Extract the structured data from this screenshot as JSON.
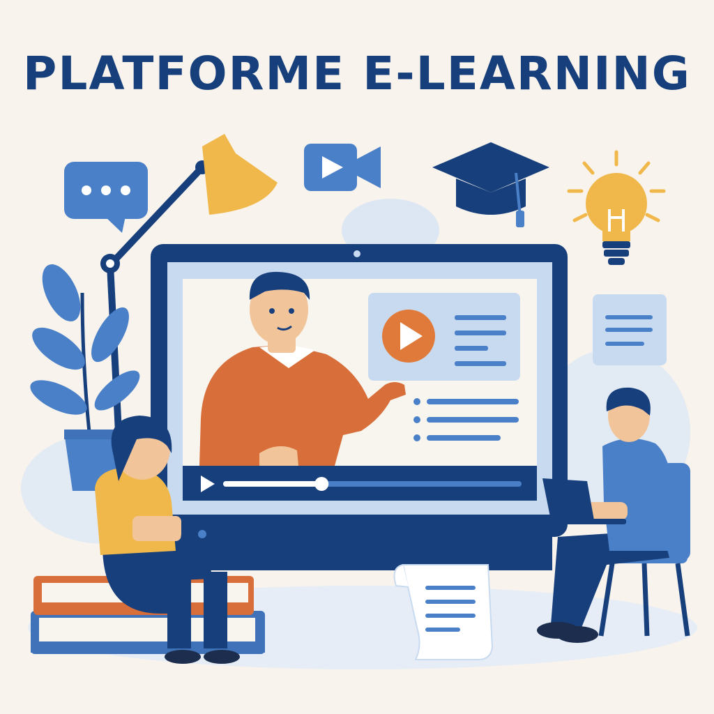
{
  "title": "PLATFORME E-LEARNING",
  "colors": {
    "navy": "#173f7c",
    "mid_blue": "#4a80c8",
    "light_blue": "#c8daf0",
    "screen_bg": "#f8f5ef",
    "orange": "#d86e3a",
    "yellow": "#f0b84a",
    "background": "#f8f3ec"
  },
  "icons": [
    "chat-bubble-icon",
    "video-camera-icon",
    "graduation-cap-icon",
    "light-bulb-icon",
    "document-icon",
    "play-icon",
    "scroll-icon"
  ],
  "video": {
    "progress_fraction": 0.33
  }
}
